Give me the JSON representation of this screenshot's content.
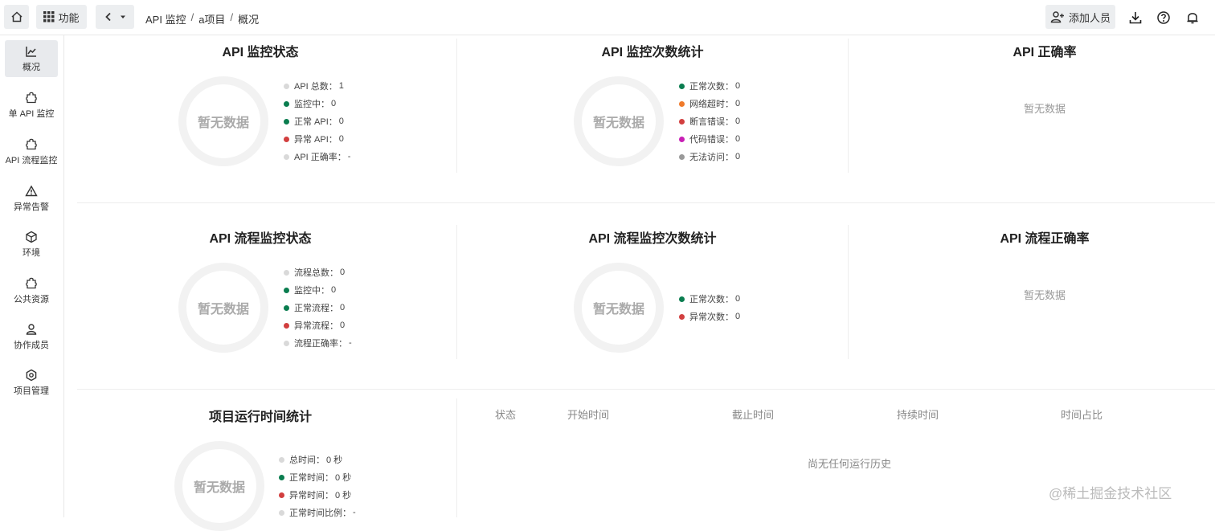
{
  "topbar": {
    "func_label": "功能",
    "breadcrumb": [
      "API 监控",
      "a项目",
      "概况"
    ],
    "add_member_label": "添加人员"
  },
  "sidebar": {
    "items": [
      {
        "label": "概况",
        "icon": "chart-line-icon",
        "active": true
      },
      {
        "label": "单 API 监控",
        "icon": "puzzle-icon"
      },
      {
        "label": "API 流程监控",
        "icon": "puzzle-icon"
      },
      {
        "label": "异常告警",
        "icon": "warning-icon"
      },
      {
        "label": "环境",
        "icon": "cube-icon"
      },
      {
        "label": "公共资源",
        "icon": "puzzle-icon"
      },
      {
        "label": "协作成员",
        "icon": "user-icon"
      },
      {
        "label": "项目管理",
        "icon": "gear-icon"
      }
    ]
  },
  "colors": {
    "gray": "#d9d9d9",
    "green": "#0a7d4f",
    "red": "#d23f3f",
    "orange": "#f07a2a",
    "magenta": "#c81fb5",
    "dgray": "#999999"
  },
  "no_data": "暂无数据",
  "cards": {
    "api_status": {
      "title": "API 监控状态",
      "legend": [
        {
          "label": "API 总数：",
          "value": "1",
          "color": "gray"
        },
        {
          "label": "监控中：",
          "value": "0",
          "color": "green"
        },
        {
          "label": "正常 API：",
          "value": "0",
          "color": "green"
        },
        {
          "label": "异常 API：",
          "value": "0",
          "color": "red"
        },
        {
          "label": "API 正确率：",
          "value": "-",
          "color": "gray"
        }
      ]
    },
    "api_count": {
      "title": "API 监控次数统计",
      "legend": [
        {
          "label": "正常次数：",
          "value": "0",
          "color": "green"
        },
        {
          "label": "网络超时：",
          "value": "0",
          "color": "orange"
        },
        {
          "label": "断言错误：",
          "value": "0",
          "color": "red"
        },
        {
          "label": "代码错误：",
          "value": "0",
          "color": "magenta"
        },
        {
          "label": "无法访问：",
          "value": "0",
          "color": "dgray"
        }
      ]
    },
    "api_rate": {
      "title": "API 正确率"
    },
    "flow_status": {
      "title": "API 流程监控状态",
      "legend": [
        {
          "label": "流程总数：",
          "value": "0",
          "color": "gray"
        },
        {
          "label": "监控中：",
          "value": "0",
          "color": "green"
        },
        {
          "label": "正常流程：",
          "value": "0",
          "color": "green"
        },
        {
          "label": "异常流程：",
          "value": "0",
          "color": "red"
        },
        {
          "label": "流程正确率：",
          "value": "-",
          "color": "gray"
        }
      ]
    },
    "flow_count": {
      "title": "API 流程监控次数统计",
      "legend": [
        {
          "label": "正常次数：",
          "value": "0",
          "color": "green"
        },
        {
          "label": "异常次数：",
          "value": "0",
          "color": "red"
        }
      ]
    },
    "flow_rate": {
      "title": "API 流程正确率"
    },
    "runtime": {
      "title": "项目运行时间统计",
      "legend": [
        {
          "label": "总时间：",
          "value": "0 秒",
          "color": "gray"
        },
        {
          "label": "正常时间：",
          "value": "0 秒",
          "color": "green"
        },
        {
          "label": "异常时间：",
          "value": "0 秒",
          "color": "red"
        },
        {
          "label": "正常时间比例：",
          "value": "-",
          "color": "gray"
        }
      ]
    }
  },
  "history_table": {
    "headers": [
      "状态",
      "开始时间",
      "截止时间",
      "持续时间",
      "时间占比"
    ],
    "empty_text": "尚无任何运行历史"
  },
  "watermark": "@稀土掘金技术社区"
}
